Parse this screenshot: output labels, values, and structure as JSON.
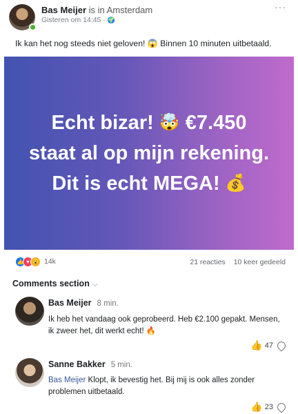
{
  "post": {
    "author": "Bas Meijer",
    "checkin_prefix": "is in",
    "location": "Amsterdam",
    "timestamp": "Gisteren om 14:45 · ",
    "globe_icon": "🌍",
    "more_icon": "···",
    "text": "Ik kan het nog steeds niet geloven! 😱 Binnen 10 minuten uitbetaald."
  },
  "banner": {
    "line1": "Echt bizar!",
    "line1_emoji": "🤯",
    "line1_amount": "€7.450",
    "line2": "staat al op mijn rekening.",
    "line3": "Dit is echt MEGA!",
    "line3_emoji": "💰"
  },
  "stats": {
    "reaction_icons": [
      "like-icon",
      "love-icon",
      "wow-icon"
    ],
    "like_glyph": "👍",
    "love_glyph": "♥",
    "wow_glyph": "😮",
    "reaction_count": "14k",
    "comments": "21 reacties",
    "shares": "10 keer gedeeld"
  },
  "comments_section": {
    "title": "Comments section",
    "chevron": "⌵"
  },
  "comments": [
    {
      "name": "Bas Meijer",
      "time": "8 min.",
      "text": "Ik heb het vandaag ook geprobeerd. Heb €2.100 gepakt. Mensen, ik zweer het, dit werkt echt! 🔥",
      "likes": "47"
    },
    {
      "name": "Sanne Bakker",
      "time": "5 min.",
      "mention": "Bas Meijer",
      "text": " Klopt, ik bevestig het. Bij mij is ook alles zonder problemen uitbetaald.",
      "likes": "23"
    }
  ],
  "colors": {
    "like_blue": "#1877f2",
    "banner_start": "#4253b0",
    "banner_end": "#c06bcc",
    "online_green": "#42b72a"
  }
}
